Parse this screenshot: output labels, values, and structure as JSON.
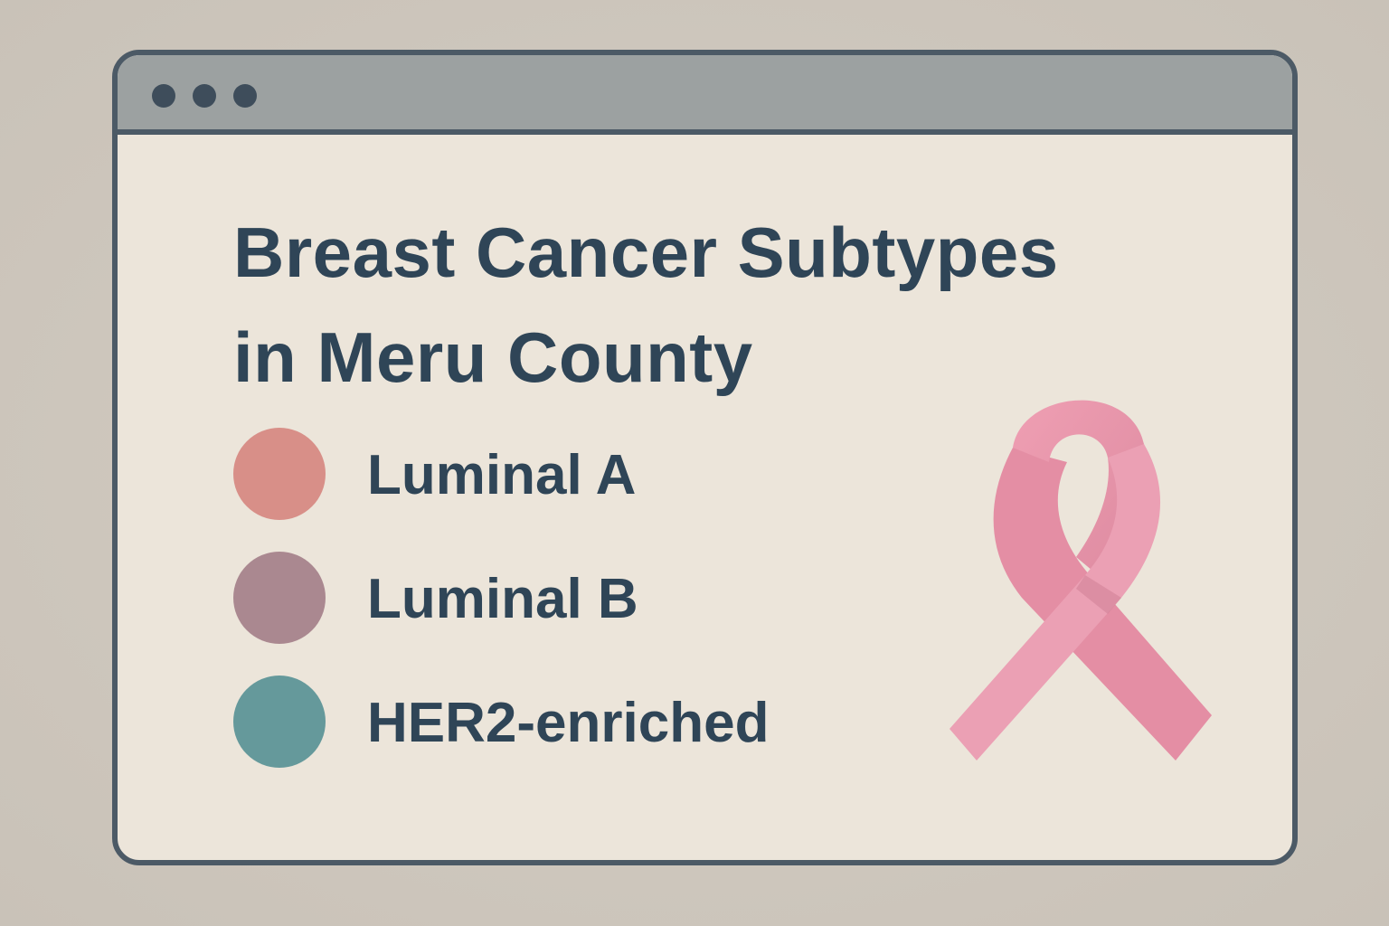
{
  "window": {
    "controls": [
      "window-dot",
      "window-dot",
      "window-dot"
    ]
  },
  "heading": {
    "line1": "Breast Cancer Subtypes",
    "line2": "in Meru County"
  },
  "legend": {
    "items": [
      {
        "label": "Luminal A",
        "color": "#d88f88"
      },
      {
        "label": "Luminal B",
        "color": "#aa8890"
      },
      {
        "label": "HER2-enriched",
        "color": "#65999b"
      }
    ]
  },
  "ribbon": {
    "icon": "pink-ribbon-icon",
    "color": "#e89aae"
  },
  "colors": {
    "frame": "#4c5a66",
    "titlebar": "#9ca1a1",
    "content_bg": "#ece5da",
    "text": "#2f4557"
  }
}
